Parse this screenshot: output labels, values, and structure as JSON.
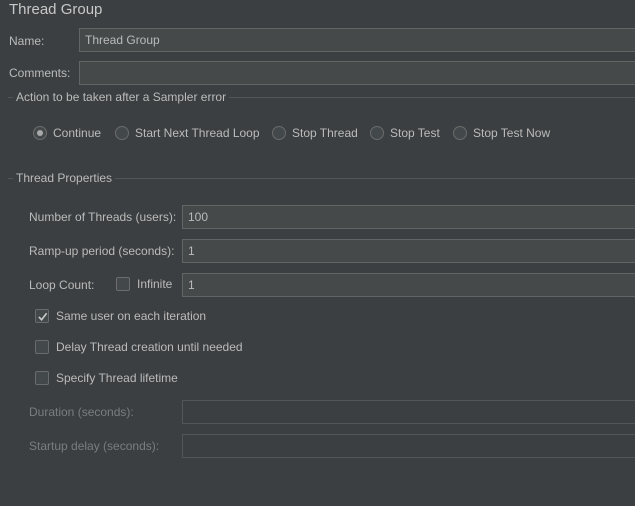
{
  "title": "Thread Group",
  "name": {
    "label": "Name:",
    "value": "Thread Group"
  },
  "comments": {
    "label": "Comments:",
    "value": ""
  },
  "sampler_error": {
    "title": "Action to be taken after a Sampler error",
    "options": [
      {
        "label": "Continue",
        "selected": true
      },
      {
        "label": "Start Next Thread Loop",
        "selected": false
      },
      {
        "label": "Stop Thread",
        "selected": false
      },
      {
        "label": "Stop Test",
        "selected": false
      },
      {
        "label": "Stop Test Now",
        "selected": false
      }
    ]
  },
  "thread_properties": {
    "title": "Thread Properties",
    "threads": {
      "label": "Number of Threads (users):",
      "value": "100"
    },
    "ramp_up": {
      "label": "Ramp-up period (seconds):",
      "value": "1"
    },
    "loop_count": {
      "label": "Loop Count:",
      "infinite_label": "Infinite",
      "infinite_checked": false,
      "value": "1"
    },
    "same_user": {
      "label": "Same user on each iteration",
      "checked": true
    },
    "delay_creation": {
      "label": "Delay Thread creation until needed",
      "checked": false
    },
    "specify_lifetime": {
      "label": "Specify Thread lifetime",
      "checked": false
    },
    "duration": {
      "label": "Duration (seconds):",
      "value": ""
    },
    "startup_delay": {
      "label": "Startup delay (seconds):",
      "value": ""
    }
  },
  "colors": {
    "background": "#3c3f41",
    "field": "#45494a",
    "text": "#bbbbbb",
    "disabled_text": "#7a7d80"
  }
}
